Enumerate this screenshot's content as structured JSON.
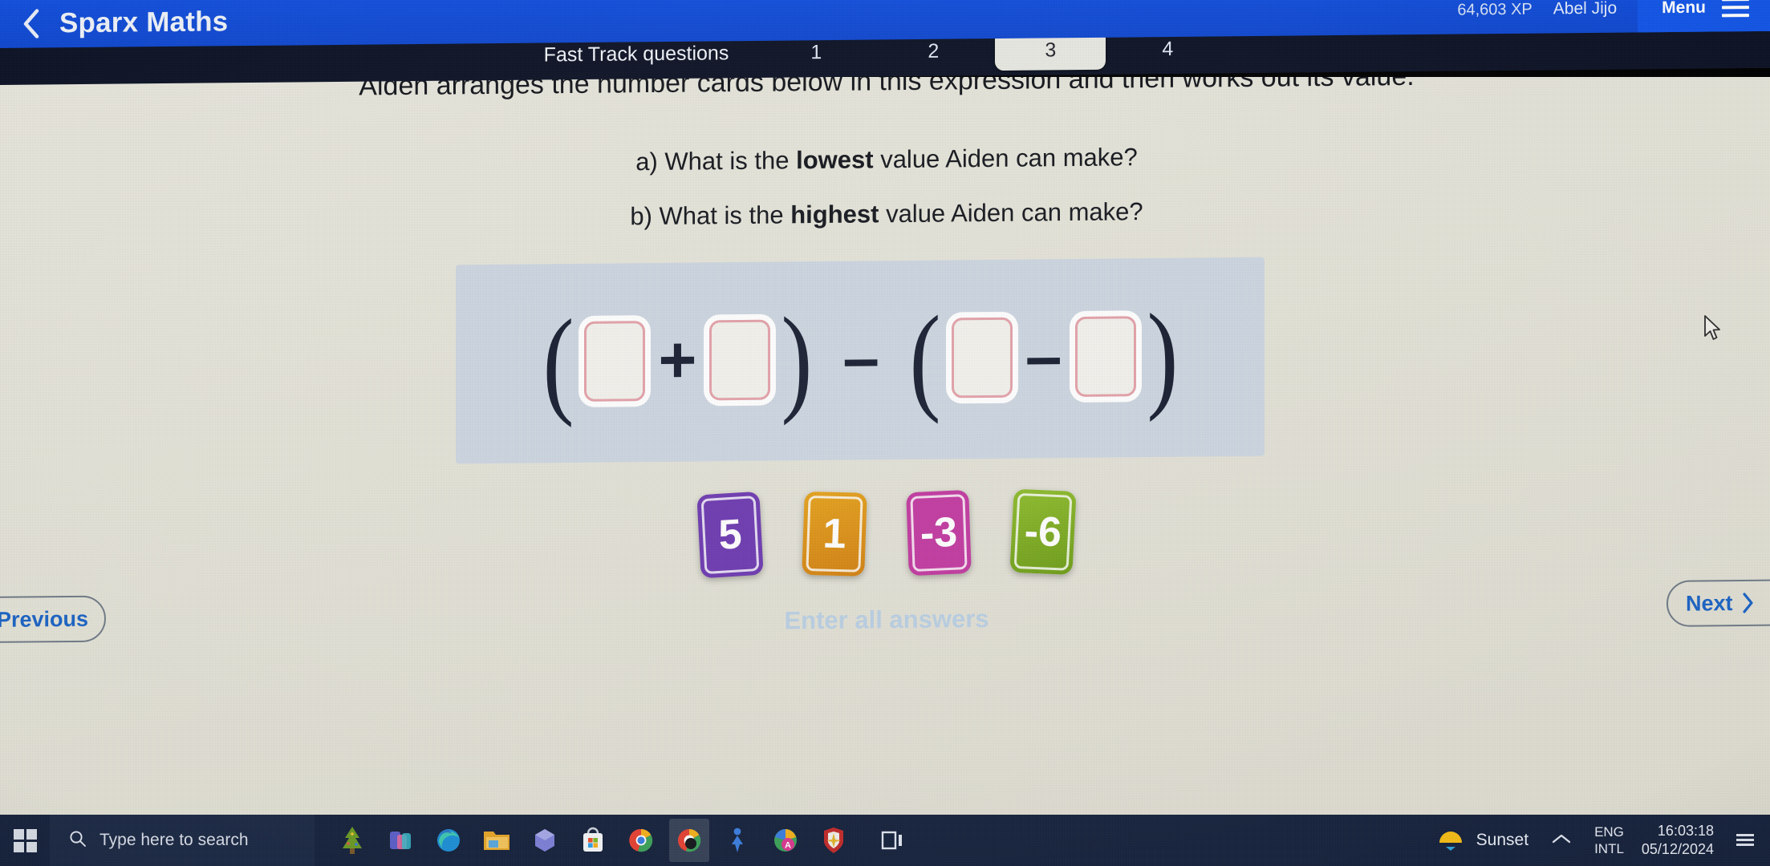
{
  "header": {
    "back_icon": "chevron-left-icon",
    "title": "Sparx Maths",
    "xp": "64,603 XP",
    "user": "Abel Jijo",
    "menu_label": "Menu",
    "menu_icon": "hamburger-icon",
    "bg_color": "#1048cf"
  },
  "subnav": {
    "label": "Fast Track questions",
    "tabs": [
      {
        "label": "1",
        "active": false
      },
      {
        "label": "2",
        "active": false
      },
      {
        "label": "3",
        "active": true
      },
      {
        "label": "4",
        "active": false
      }
    ],
    "bg_color": "#0d1326",
    "active_tab_bg": "#e8e8e2"
  },
  "question": {
    "intro": "Aiden arranges the number cards below in this expression and then works out its value.",
    "part_a": {
      "prefix": "a) What is the ",
      "emphasis": "lowest",
      "suffix": " value Aiden can make?"
    },
    "part_b": {
      "prefix": "b) What is the ",
      "emphasis": "highest",
      "suffix": " value Aiden can make?"
    }
  },
  "expression": {
    "panel_color": "#ccd5e0",
    "tokens": [
      "(",
      "box",
      "+",
      "box",
      ")",
      "–",
      "(",
      "box",
      "–",
      "box",
      ")"
    ],
    "open_paren": "(",
    "close_paren": ")",
    "plus": "+",
    "minus": "–",
    "answer_boxes": [
      {
        "value": "",
        "name": "answer-box-1"
      },
      {
        "value": "",
        "name": "answer-box-2"
      },
      {
        "value": "",
        "name": "answer-box-3"
      },
      {
        "value": "",
        "name": "answer-box-4"
      }
    ],
    "box_border_color": "#e3a0a8"
  },
  "number_cards": [
    {
      "label": "5",
      "color": "#6c38b0",
      "name": "number-card-5"
    },
    {
      "label": "1",
      "color": "#dd8e18",
      "name": "number-card-1"
    },
    {
      "label": "-3",
      "color": "#c1389f",
      "name": "number-card-minus3"
    },
    {
      "label": "-6",
      "color": "#79ad22",
      "name": "number-card-minus6"
    }
  ],
  "footer": {
    "previous_label": "Previous",
    "previous_icon": "chevron-left-icon",
    "next_label": "Next",
    "next_icon": "chevron-right-icon",
    "status_message": "Enter all answers",
    "status_color": "#b9cfe3",
    "link_color": "#1b63c4"
  },
  "taskbar": {
    "start_icon": "windows-logo-icon",
    "search_placeholder": "Type here to search",
    "search_icon": "search-icon",
    "apps": [
      {
        "name": "taskbar-icon-teams"
      },
      {
        "name": "taskbar-icon-edge"
      },
      {
        "name": "taskbar-icon-file-explorer"
      },
      {
        "name": "taskbar-icon-office"
      },
      {
        "name": "taskbar-icon-microsoft-store"
      },
      {
        "name": "taskbar-icon-chrome"
      },
      {
        "name": "taskbar-icon-chrome-active",
        "active": true
      },
      {
        "name": "taskbar-icon-person"
      },
      {
        "name": "taskbar-icon-chrome-profile"
      },
      {
        "name": "taskbar-icon-shield"
      }
    ],
    "task_view_icon": "task-view-icon",
    "tray": {
      "weather_icon": "sunset-icon",
      "weather_label": "Sunset",
      "overflow_icon": "chevron-up-icon",
      "language_primary": "ENG",
      "language_secondary": "INTL",
      "time": "16:03:18",
      "date": "05/12/2024",
      "notification_icon": "notification-icon"
    }
  },
  "cursor": {
    "icon": "mouse-pointer-icon"
  }
}
